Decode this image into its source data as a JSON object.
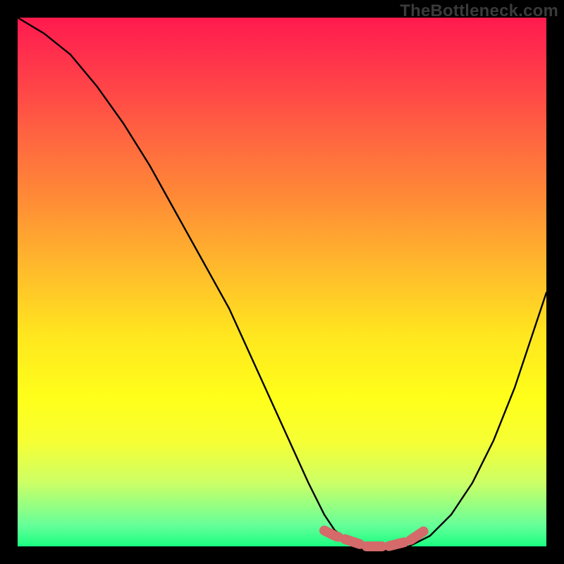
{
  "watermark": "TheBottleneck.com",
  "colors": {
    "background": "#000000",
    "curve": "#000000",
    "flat_marker": "#d46a6a"
  },
  "chart_data": {
    "type": "line",
    "title": "",
    "xlabel": "",
    "ylabel": "",
    "xlim": [
      0,
      100
    ],
    "ylim": [
      0,
      100
    ],
    "grid": false,
    "legend": false,
    "series": [
      {
        "name": "bottleneck-curve",
        "x": [
          0,
          5,
          10,
          15,
          20,
          25,
          30,
          35,
          40,
          45,
          50,
          55,
          58,
          60,
          63,
          66,
          70,
          74,
          78,
          82,
          86,
          90,
          94,
          98,
          100
        ],
        "values": [
          100,
          97,
          93,
          87,
          80,
          72,
          63,
          54,
          45,
          34,
          23,
          12,
          6,
          3,
          1,
          0,
          0,
          0,
          2,
          6,
          12,
          20,
          30,
          42,
          48
        ]
      },
      {
        "name": "optimal-flat-region",
        "x": [
          58,
          60,
          63,
          66,
          70,
          74,
          77
        ],
        "values": [
          3,
          2,
          1,
          0,
          0,
          1,
          3
        ]
      }
    ],
    "annotations": []
  }
}
